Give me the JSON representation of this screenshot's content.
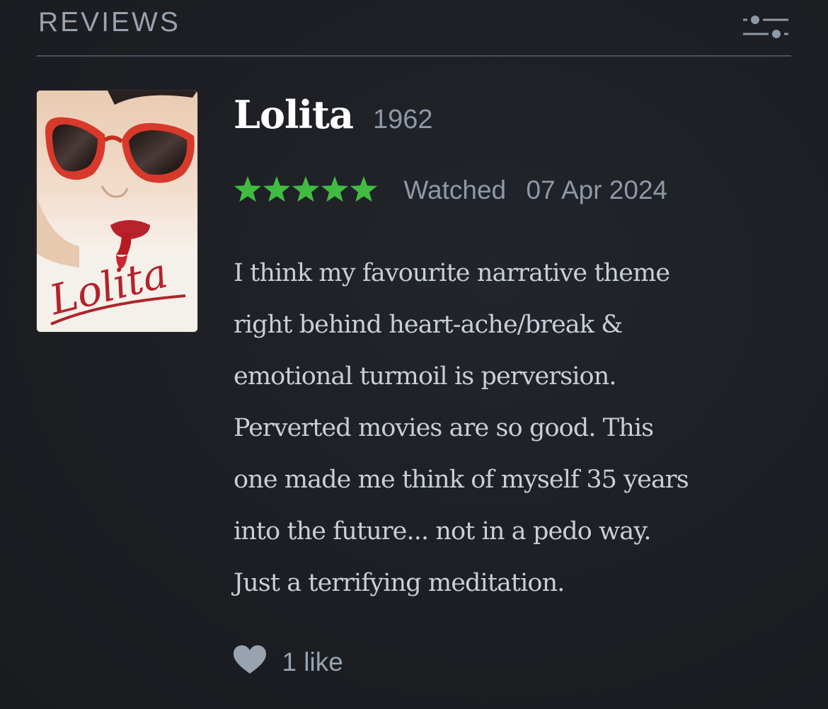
{
  "section": {
    "title": "REVIEWS",
    "filter_icon": "sliders-filter-icon"
  },
  "review": {
    "poster": {
      "icon": "film-poster-image",
      "script_title": "Lolita"
    },
    "film_title": "Lolita",
    "film_year": "1962",
    "rating": 5,
    "rating_max": 5,
    "star_color": "#40bc40",
    "watched_label": "Watched",
    "watched_date": "07 Apr 2024",
    "body_lines": [
      "I think my favourite narrative theme",
      "right behind heart-ache/break &",
      "emotional turmoil is perversion.",
      "Perverted movies are so good. This",
      "one made me think of myself 35 years",
      "into the future... not in a pedo way.",
      "Just a terrifying meditation."
    ],
    "likes": {
      "icon": "heart-icon",
      "text": "1 like"
    }
  },
  "colors": {
    "background": "#1c1e23",
    "header_text": "#98a2b0",
    "divider": "#4a5160",
    "title": "#ffffff",
    "meta_text": "#8f98a6",
    "body_text": "#c8cfd8",
    "green": "#40bc40"
  }
}
